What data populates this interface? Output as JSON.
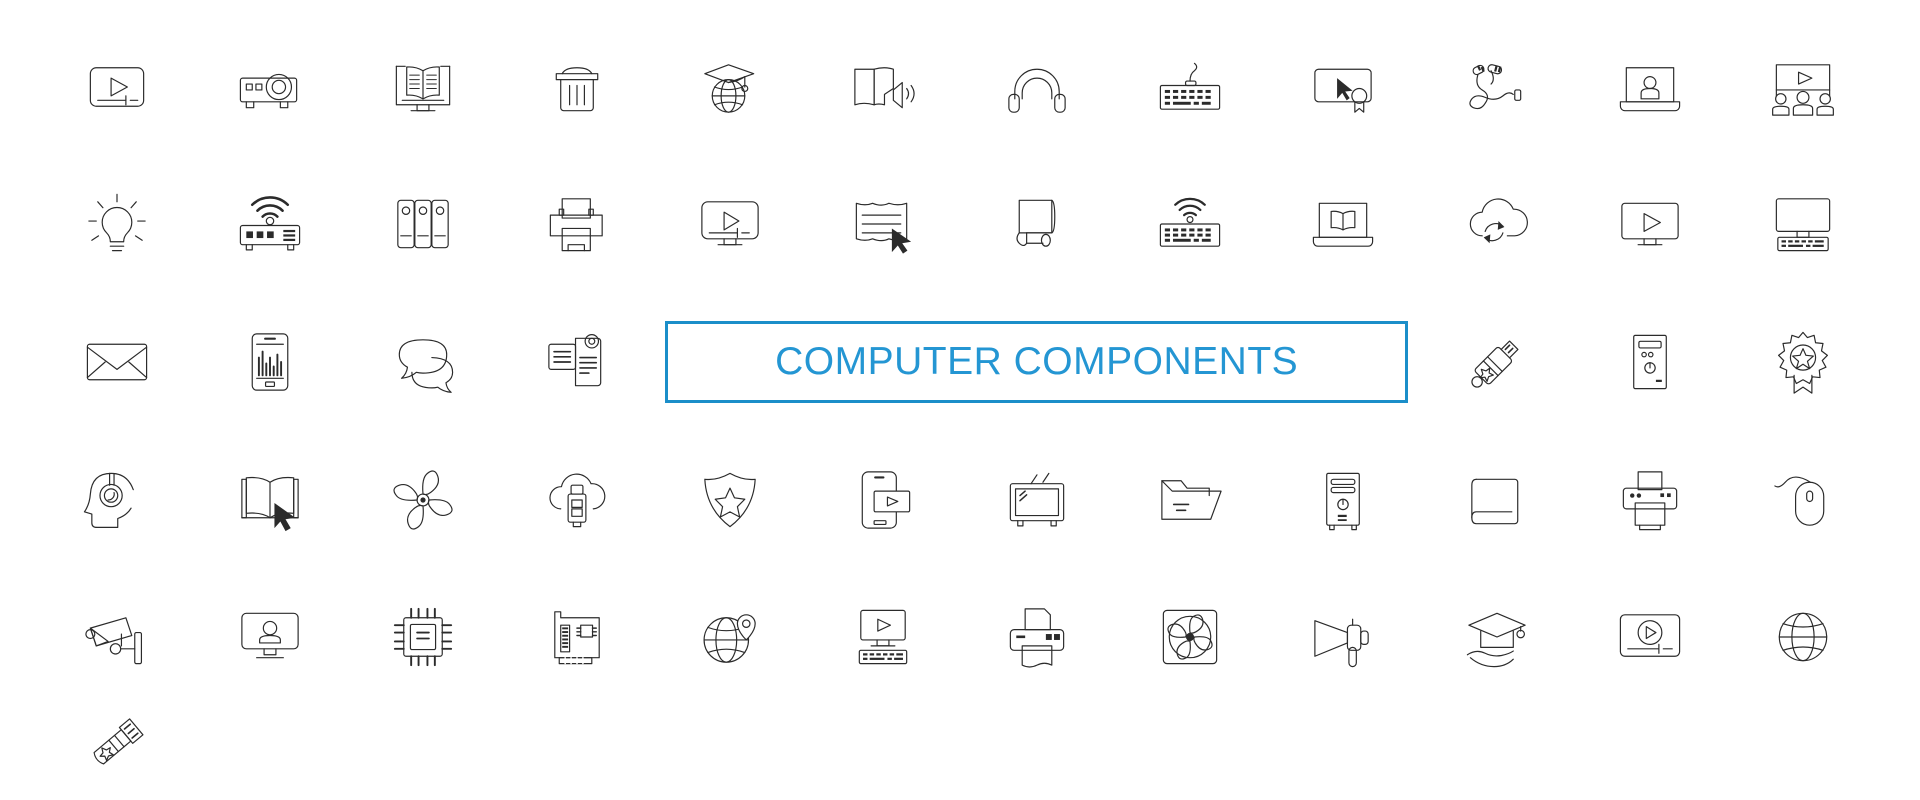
{
  "page": {
    "background": "#ffffff",
    "stroke_color": "#2b2b2b",
    "accent_color": "#2496d3",
    "border_color": "#1b8ec9",
    "columns": 12,
    "rows": 5,
    "total_icons": 60
  },
  "title_box": {
    "label": "COMPUTER COMPONENTS",
    "text_color": "#2496d3",
    "border_color": "#1b8ec9",
    "grid_position": "row 3, columns 5-9"
  },
  "icons": [
    {
      "row": 1,
      "col": 1,
      "name": "video-player-icon",
      "label": "Video player"
    },
    {
      "row": 1,
      "col": 2,
      "name": "projector-icon",
      "label": "Projector"
    },
    {
      "row": 1,
      "col": 3,
      "name": "online-book-monitor-icon",
      "label": "Online book on monitor"
    },
    {
      "row": 1,
      "col": 4,
      "name": "trash-bin-icon",
      "label": "Trash bin"
    },
    {
      "row": 1,
      "col": 5,
      "name": "global-education-icon",
      "label": "Graduation cap on globe"
    },
    {
      "row": 1,
      "col": 6,
      "name": "audiobook-icon",
      "label": "Audiobook"
    },
    {
      "row": 1,
      "col": 7,
      "name": "headphones-icon",
      "label": "Headphones"
    },
    {
      "row": 1,
      "col": 8,
      "name": "wired-keyboard-icon",
      "label": "Wired keyboard"
    },
    {
      "row": 1,
      "col": 9,
      "name": "certificate-cursor-icon",
      "label": "Certificate with cursor"
    },
    {
      "row": 1,
      "col": 10,
      "name": "earphones-cable-icon",
      "label": "Earphones with cable"
    },
    {
      "row": 1,
      "col": 11,
      "name": "laptop-user-icon",
      "label": "Laptop with user"
    },
    {
      "row": 1,
      "col": 12,
      "name": "presentation-audience-icon",
      "label": "Presentation with audience"
    },
    {
      "row": 2,
      "col": 1,
      "name": "light-bulb-icon",
      "label": "Light bulb idea"
    },
    {
      "row": 2,
      "col": 2,
      "name": "wifi-router-icon",
      "label": "WiFi router"
    },
    {
      "row": 2,
      "col": 3,
      "name": "binders-archive-icon",
      "label": "Binders archive"
    },
    {
      "row": 2,
      "col": 4,
      "name": "printer-icon",
      "label": "Printer"
    },
    {
      "row": 2,
      "col": 5,
      "name": "monitor-video-icon",
      "label": "Monitor playing video"
    },
    {
      "row": 2,
      "col": 6,
      "name": "document-cursor-icon",
      "label": "Document with cursor"
    },
    {
      "row": 2,
      "col": 7,
      "name": "book-bookmark-icon",
      "label": "Book with bookmark"
    },
    {
      "row": 2,
      "col": 8,
      "name": "wireless-keyboard-icon",
      "label": "Wireless keyboard"
    },
    {
      "row": 2,
      "col": 9,
      "name": "laptop-book-icon",
      "label": "Laptop with open book"
    },
    {
      "row": 2,
      "col": 10,
      "name": "cloud-sync-icon",
      "label": "Cloud sync"
    },
    {
      "row": 2,
      "col": 11,
      "name": "monitor-play-icon",
      "label": "Monitor with play button"
    },
    {
      "row": 2,
      "col": 12,
      "name": "desktop-keyboard-icon",
      "label": "Desktop monitor and keyboard"
    },
    {
      "row": 3,
      "col": 1,
      "name": "envelope-mail-icon",
      "label": "Email envelope"
    },
    {
      "row": 3,
      "col": 2,
      "name": "tablet-chart-icon",
      "label": "Tablet with chart"
    },
    {
      "row": 3,
      "col": 3,
      "name": "chat-bubbles-icon",
      "label": "Chat bubbles"
    },
    {
      "row": 3,
      "col": 4,
      "name": "documents-stack-icon",
      "label": "Documents stack"
    },
    {
      "row": 3,
      "col": 10,
      "name": "usb-flash-star-icon",
      "label": "USB flash drive with star"
    },
    {
      "row": 3,
      "col": 11,
      "name": "computer-tower-icon",
      "label": "Computer tower"
    },
    {
      "row": 3,
      "col": 12,
      "name": "award-badge-star-icon",
      "label": "Award badge with star"
    },
    {
      "row": 3,
      "col": 13,
      "name": "head-headphones-icon",
      "label": "Head with headphones"
    },
    {
      "row": 4,
      "col": 1,
      "name": "open-book-cursor-icon",
      "label": "Open book with cursor"
    },
    {
      "row": 4,
      "col": 2,
      "name": "cooling-fan-icon",
      "label": "Cooling fan blades"
    },
    {
      "row": 4,
      "col": 3,
      "name": "cloud-usb-icon",
      "label": "Cloud with USB drive"
    },
    {
      "row": 4,
      "col": 4,
      "name": "shield-star-icon",
      "label": "Shield with star"
    },
    {
      "row": 4,
      "col": 5,
      "name": "mobile-video-icon",
      "label": "Mobile phone video"
    },
    {
      "row": 4,
      "col": 6,
      "name": "retro-tv-icon",
      "label": "Retro television"
    },
    {
      "row": 4,
      "col": 7,
      "name": "open-folder-icon",
      "label": "Open folder"
    },
    {
      "row": 4,
      "col": 8,
      "name": "pc-tower-power-icon",
      "label": "PC tower with power button"
    },
    {
      "row": 4,
      "col": 9,
      "name": "closed-book-icon",
      "label": "Closed book"
    },
    {
      "row": 4,
      "col": 10,
      "name": "printer-paper-icon",
      "label": "Printer with paper"
    },
    {
      "row": 4,
      "col": 11,
      "name": "computer-mouse-icon",
      "label": "Computer mouse with cable"
    },
    {
      "row": 4,
      "col": 12,
      "name": "security-camera-icon",
      "label": "Security camera"
    },
    {
      "row": 5,
      "col": 1,
      "name": "monitor-user-icon",
      "label": "Monitor with user"
    },
    {
      "row": 5,
      "col": 2,
      "name": "cpu-chip-icon",
      "label": "CPU processor chip"
    },
    {
      "row": 5,
      "col": 3,
      "name": "graphics-card-icon",
      "label": "Graphics expansion card"
    },
    {
      "row": 5,
      "col": 4,
      "name": "globe-location-pin-icon",
      "label": "Globe with location pin"
    },
    {
      "row": 5,
      "col": 5,
      "name": "desktop-video-keyboard-icon",
      "label": "Desktop video with keyboard"
    },
    {
      "row": 5,
      "col": 6,
      "name": "printer-output-icon",
      "label": "Printer printing page"
    },
    {
      "row": 5,
      "col": 7,
      "name": "case-fan-icon",
      "label": "Case cooling fan"
    },
    {
      "row": 5,
      "col": 8,
      "name": "megaphone-icon",
      "label": "Megaphone"
    },
    {
      "row": 5,
      "col": 9,
      "name": "scholarship-hand-icon",
      "label": "Graduation cap on hand"
    },
    {
      "row": 5,
      "col": 10,
      "name": "video-play-frame-icon",
      "label": "Video frame with play"
    },
    {
      "row": 5,
      "col": 11,
      "name": "globe-icon",
      "label": "Globe"
    },
    {
      "row": 5,
      "col": 12,
      "name": "usb-tag-star-icon",
      "label": "USB tag with star"
    }
  ]
}
